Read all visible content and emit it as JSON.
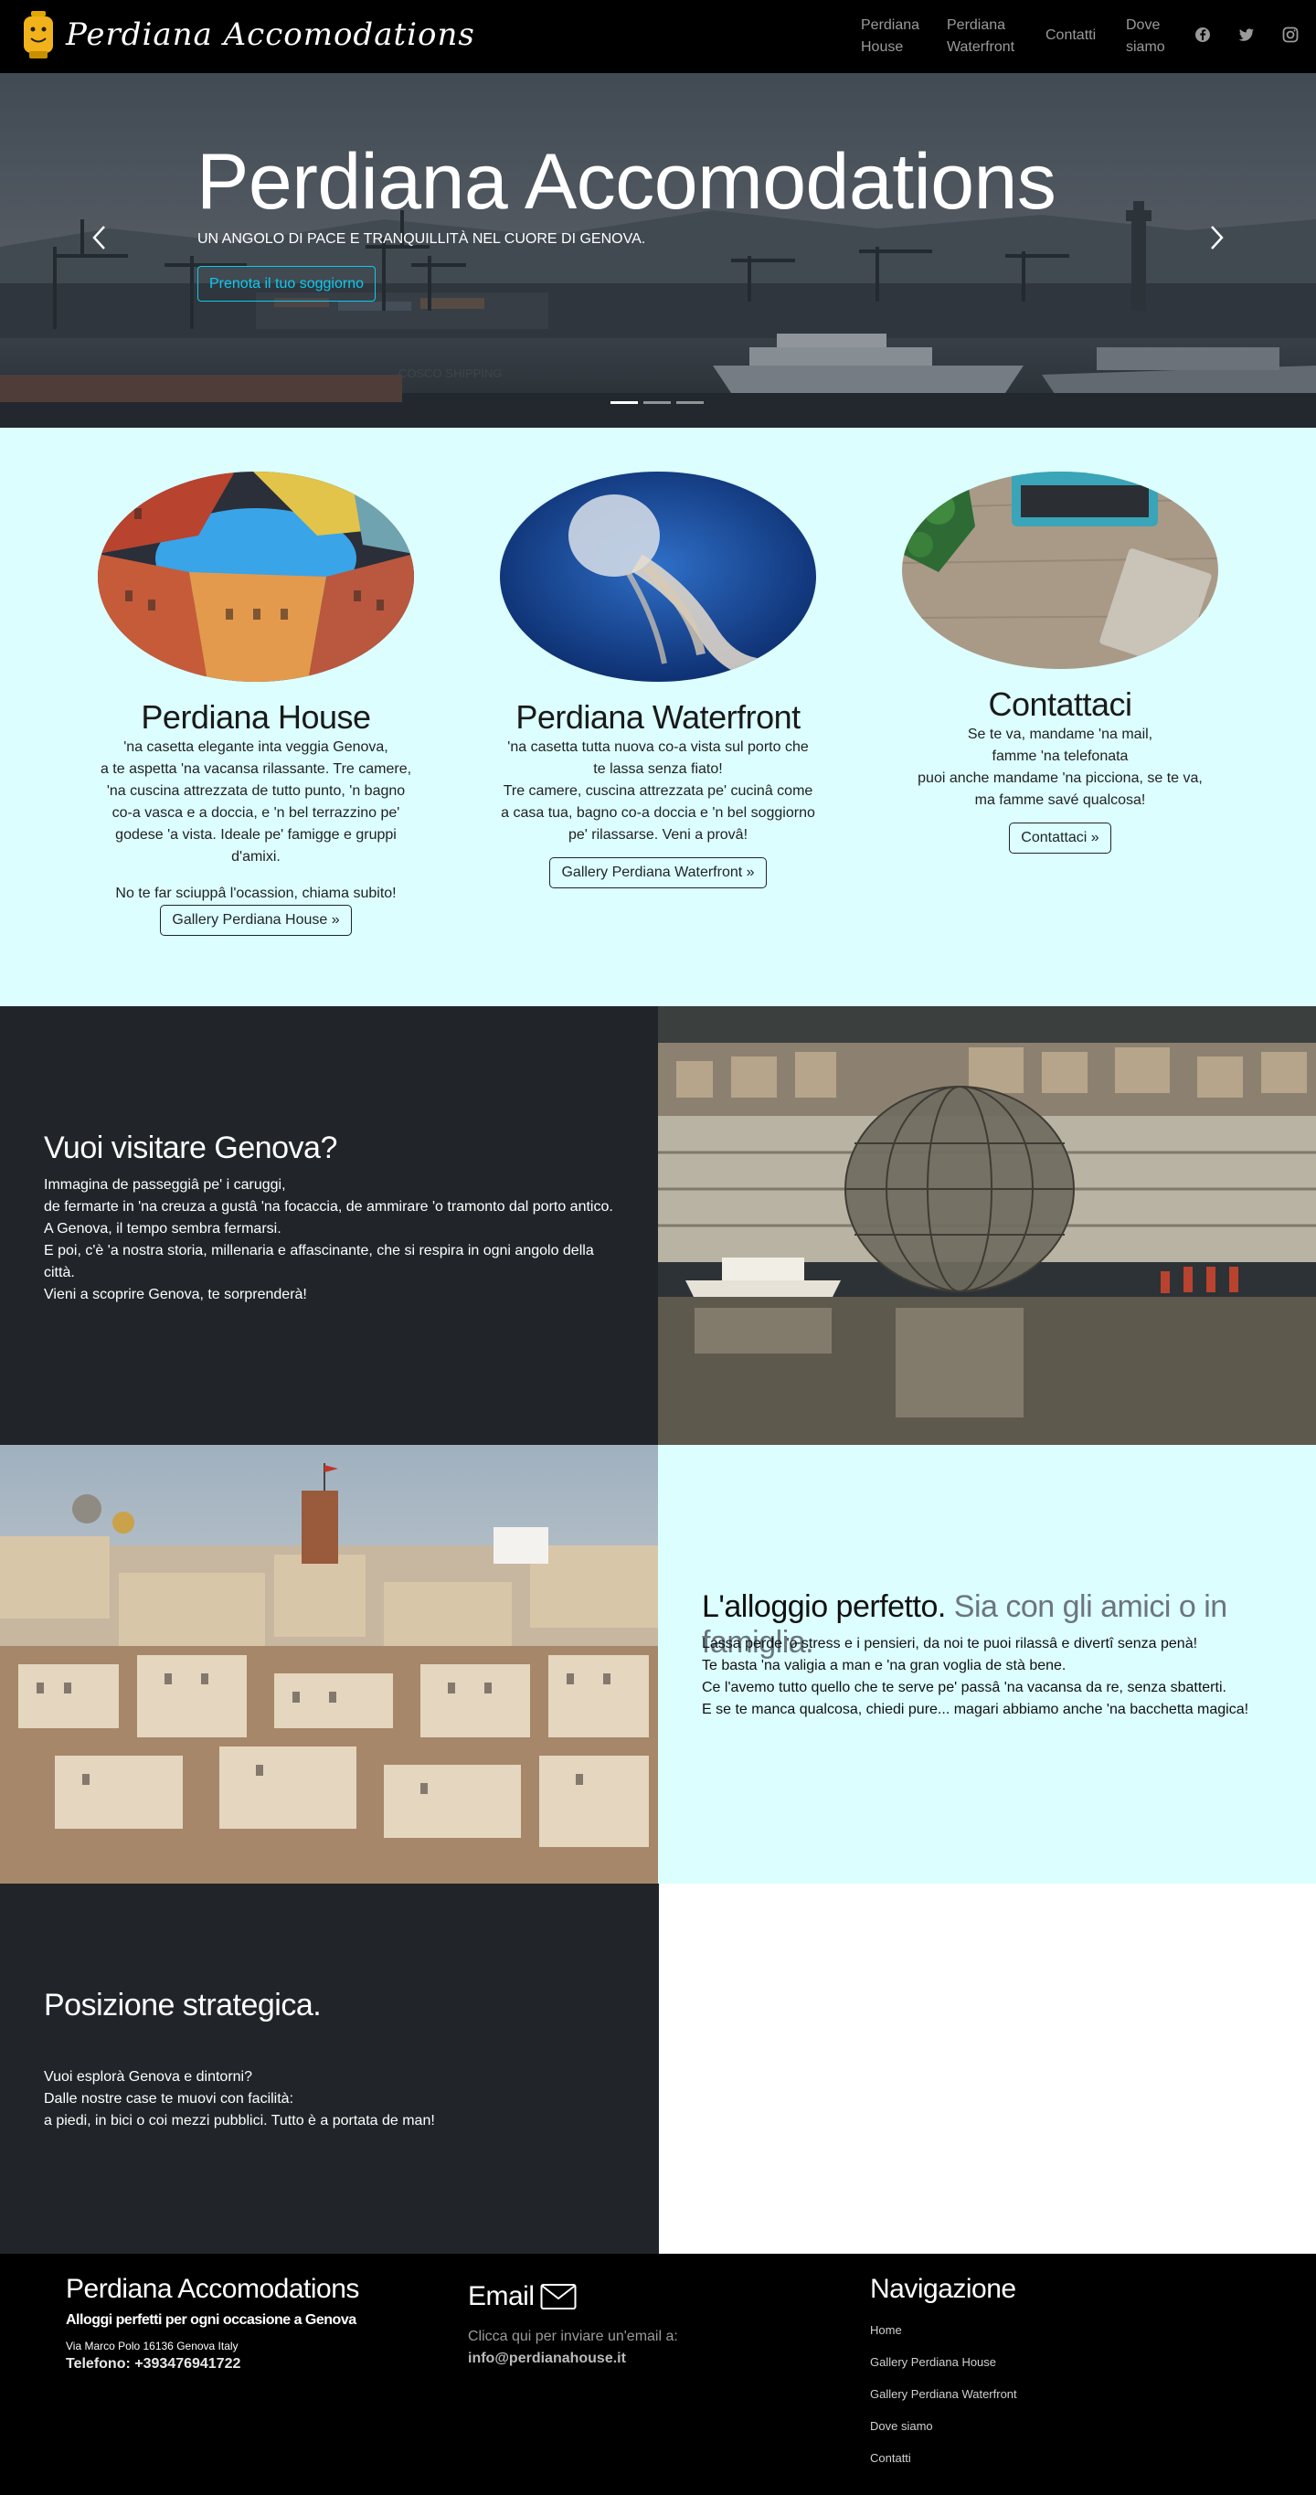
{
  "navbar": {
    "brand": "Perdiana Accomodations",
    "links": [
      {
        "line1": "Perdiana",
        "line2": "House"
      },
      {
        "line1": "Perdiana",
        "line2": "Waterfront"
      },
      {
        "line1": "Contatti",
        "line2": ""
      },
      {
        "line1": "Dove",
        "line2": "siamo"
      }
    ],
    "social_icons": [
      "facebook-icon",
      "twitter-icon",
      "instagram-icon"
    ]
  },
  "hero": {
    "title": "Perdiana Accomodations",
    "subtitle": "UN ANGOLO DI PACE E TRANQUILLITÀ NEL CUORE DI GENOVA.",
    "button": "Prenota il tuo soggiorno",
    "ship_text": "COSCO SHIPPING",
    "slides": 3,
    "active_slide": 1
  },
  "cards": [
    {
      "title": "Perdiana House",
      "lines": [
        "'na casetta elegante inta veggia Genova,",
        "a te aspetta 'na vacansa rilassante. Tre camere,",
        "'na cuscina attrezzata de tutto punto, 'n bagno",
        "co-a vasca e a doccia, e 'n bel terrazzino pe'",
        "godese 'a vista. Ideale pe' famigge e gruppi",
        "d'amixi."
      ],
      "extra": "No te far sciuppâ l'ocassion, chiama subito!",
      "button": "Gallery Perdiana House »"
    },
    {
      "title": "Perdiana Waterfront",
      "lines": [
        "'na casetta tutta nuova co-a vista sul porto che",
        "te lassa senza fiato!",
        "Tre camere, cuscina attrezzata pe' cucinâ come",
        "a casa tua, bagno co-a doccia e 'n bel soggiorno",
        "pe' rilassarse. Veni a provâ!"
      ],
      "button": "Gallery Perdiana Waterfront »"
    },
    {
      "title": "Contattaci",
      "lines": [
        "Se te va, mandame 'na mail,",
        "famme 'na telefonata",
        "puoi anche mandame 'na picciona, se te va,",
        "ma famme savé qualcosa!"
      ],
      "button": "Contattaci »"
    }
  ],
  "feature1": {
    "title": "Vuoi visitare Genova?",
    "lines": [
      "Immagina de passeggiâ pe' i caruggi,",
      "de fermarte in 'na creuza a gustâ 'na focaccia, de ammirare 'o tramonto dal porto antico.",
      "A Genova, il tempo sembra fermarsi.",
      "E poi, c'è 'a nostra storia, millenaria e affascinante, che si respira in ogni angolo della",
      "città.",
      "Vieni a scoprire Genova, te sorprenderà!"
    ]
  },
  "feature2": {
    "title_strong": "L'alloggio perfetto.",
    "title_muted": "Sia con gli amici o in famiglia.",
    "lines": [
      "Lassa perde 'o stress e i pensieri, da noi te puoi rilassâ e divertî senza penà!",
      "Te basta 'na valigia a man e 'na gran voglia de stà bene.",
      "Ce l'avemo tutto quello che te serve pe' passâ 'na vacansa da re, senza sbatterti.",
      "E se te manca qualcosa, chiedi pure... magari abbiamo anche 'na bacchetta magica!"
    ]
  },
  "feature3": {
    "title": "Posizione strategica.",
    "lines": [
      "Vuoi esplorà Genova e dintorni?",
      "Dalle nostre case te muovi con facilità:",
      "a piedi, in bici o coi mezzi pubblici. Tutto è a portata de man!"
    ]
  },
  "footer": {
    "brand": "Perdiana Accomodations",
    "tagline": "Alloggi perfetti per ogni occasione a Genova",
    "address": "Via Marco Polo 16136 Genova Italy",
    "phone": "Telefono: +393476941722",
    "email_title": "Email",
    "email_hint": "Clicca qui per inviare un'email a:",
    "email": "info@perdianahouse.it",
    "nav_title": "Navigazione",
    "nav_links": [
      "Home",
      "Gallery Perdiana House",
      "Gallery Perdiana Waterfront",
      "Dove siamo",
      "Contatti"
    ]
  },
  "colors": {
    "navbar_bg": "#000000",
    "accent_cyan": "#0dcaf0",
    "light_section": "#dcfefe",
    "dark_section": "#212529",
    "muted_title": "#6c757d"
  }
}
